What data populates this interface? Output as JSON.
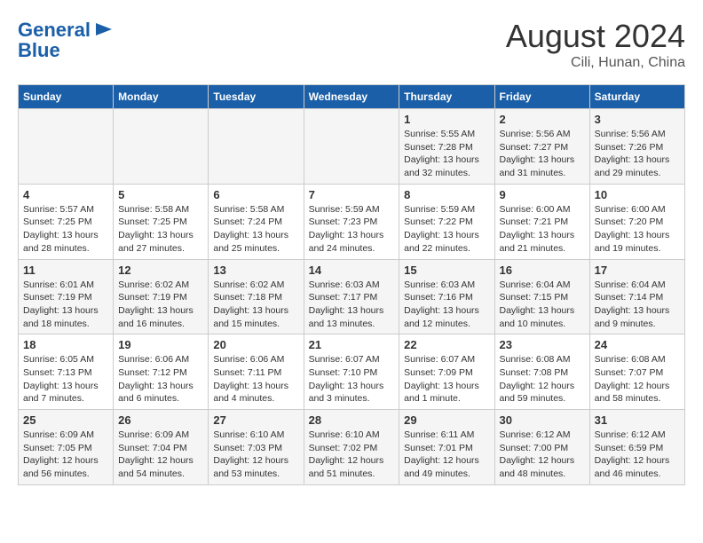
{
  "header": {
    "logo_line1": "General",
    "logo_line2": "Blue",
    "month": "August 2024",
    "location": "Cili, Hunan, China"
  },
  "weekdays": [
    "Sunday",
    "Monday",
    "Tuesday",
    "Wednesday",
    "Thursday",
    "Friday",
    "Saturday"
  ],
  "weeks": [
    [
      {
        "day": "",
        "detail": ""
      },
      {
        "day": "",
        "detail": ""
      },
      {
        "day": "",
        "detail": ""
      },
      {
        "day": "",
        "detail": ""
      },
      {
        "day": "1",
        "detail": "Sunrise: 5:55 AM\nSunset: 7:28 PM\nDaylight: 13 hours\nand 32 minutes."
      },
      {
        "day": "2",
        "detail": "Sunrise: 5:56 AM\nSunset: 7:27 PM\nDaylight: 13 hours\nand 31 minutes."
      },
      {
        "day": "3",
        "detail": "Sunrise: 5:56 AM\nSunset: 7:26 PM\nDaylight: 13 hours\nand 29 minutes."
      }
    ],
    [
      {
        "day": "4",
        "detail": "Sunrise: 5:57 AM\nSunset: 7:25 PM\nDaylight: 13 hours\nand 28 minutes."
      },
      {
        "day": "5",
        "detail": "Sunrise: 5:58 AM\nSunset: 7:25 PM\nDaylight: 13 hours\nand 27 minutes."
      },
      {
        "day": "6",
        "detail": "Sunrise: 5:58 AM\nSunset: 7:24 PM\nDaylight: 13 hours\nand 25 minutes."
      },
      {
        "day": "7",
        "detail": "Sunrise: 5:59 AM\nSunset: 7:23 PM\nDaylight: 13 hours\nand 24 minutes."
      },
      {
        "day": "8",
        "detail": "Sunrise: 5:59 AM\nSunset: 7:22 PM\nDaylight: 13 hours\nand 22 minutes."
      },
      {
        "day": "9",
        "detail": "Sunrise: 6:00 AM\nSunset: 7:21 PM\nDaylight: 13 hours\nand 21 minutes."
      },
      {
        "day": "10",
        "detail": "Sunrise: 6:00 AM\nSunset: 7:20 PM\nDaylight: 13 hours\nand 19 minutes."
      }
    ],
    [
      {
        "day": "11",
        "detail": "Sunrise: 6:01 AM\nSunset: 7:19 PM\nDaylight: 13 hours\nand 18 minutes."
      },
      {
        "day": "12",
        "detail": "Sunrise: 6:02 AM\nSunset: 7:19 PM\nDaylight: 13 hours\nand 16 minutes."
      },
      {
        "day": "13",
        "detail": "Sunrise: 6:02 AM\nSunset: 7:18 PM\nDaylight: 13 hours\nand 15 minutes."
      },
      {
        "day": "14",
        "detail": "Sunrise: 6:03 AM\nSunset: 7:17 PM\nDaylight: 13 hours\nand 13 minutes."
      },
      {
        "day": "15",
        "detail": "Sunrise: 6:03 AM\nSunset: 7:16 PM\nDaylight: 13 hours\nand 12 minutes."
      },
      {
        "day": "16",
        "detail": "Sunrise: 6:04 AM\nSunset: 7:15 PM\nDaylight: 13 hours\nand 10 minutes."
      },
      {
        "day": "17",
        "detail": "Sunrise: 6:04 AM\nSunset: 7:14 PM\nDaylight: 13 hours\nand 9 minutes."
      }
    ],
    [
      {
        "day": "18",
        "detail": "Sunrise: 6:05 AM\nSunset: 7:13 PM\nDaylight: 13 hours\nand 7 minutes."
      },
      {
        "day": "19",
        "detail": "Sunrise: 6:06 AM\nSunset: 7:12 PM\nDaylight: 13 hours\nand 6 minutes."
      },
      {
        "day": "20",
        "detail": "Sunrise: 6:06 AM\nSunset: 7:11 PM\nDaylight: 13 hours\nand 4 minutes."
      },
      {
        "day": "21",
        "detail": "Sunrise: 6:07 AM\nSunset: 7:10 PM\nDaylight: 13 hours\nand 3 minutes."
      },
      {
        "day": "22",
        "detail": "Sunrise: 6:07 AM\nSunset: 7:09 PM\nDaylight: 13 hours\nand 1 minute."
      },
      {
        "day": "23",
        "detail": "Sunrise: 6:08 AM\nSunset: 7:08 PM\nDaylight: 12 hours\nand 59 minutes."
      },
      {
        "day": "24",
        "detail": "Sunrise: 6:08 AM\nSunset: 7:07 PM\nDaylight: 12 hours\nand 58 minutes."
      }
    ],
    [
      {
        "day": "25",
        "detail": "Sunrise: 6:09 AM\nSunset: 7:05 PM\nDaylight: 12 hours\nand 56 minutes."
      },
      {
        "day": "26",
        "detail": "Sunrise: 6:09 AM\nSunset: 7:04 PM\nDaylight: 12 hours\nand 54 minutes."
      },
      {
        "day": "27",
        "detail": "Sunrise: 6:10 AM\nSunset: 7:03 PM\nDaylight: 12 hours\nand 53 minutes."
      },
      {
        "day": "28",
        "detail": "Sunrise: 6:10 AM\nSunset: 7:02 PM\nDaylight: 12 hours\nand 51 minutes."
      },
      {
        "day": "29",
        "detail": "Sunrise: 6:11 AM\nSunset: 7:01 PM\nDaylight: 12 hours\nand 49 minutes."
      },
      {
        "day": "30",
        "detail": "Sunrise: 6:12 AM\nSunset: 7:00 PM\nDaylight: 12 hours\nand 48 minutes."
      },
      {
        "day": "31",
        "detail": "Sunrise: 6:12 AM\nSunset: 6:59 PM\nDaylight: 12 hours\nand 46 minutes."
      }
    ]
  ]
}
